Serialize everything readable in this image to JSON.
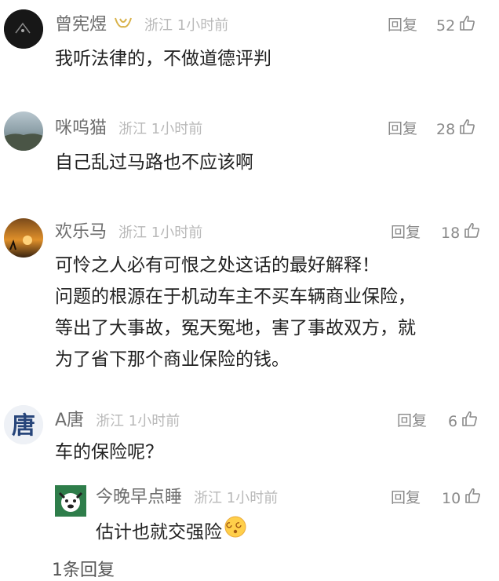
{
  "comments": [
    {
      "name": "曾宪煜",
      "meta": "浙江 1小时前",
      "reply": "回复",
      "likes": "52",
      "text": [
        "我听法律的，不做道德评判"
      ]
    },
    {
      "name": "咪呜猫",
      "meta": "浙江 1小时前",
      "reply": "回复",
      "likes": "28",
      "text": [
        "自己乱过马路也不应该啊"
      ]
    },
    {
      "name": "欢乐马",
      "meta": "浙江 1小时前",
      "reply": "回复",
      "likes": "18",
      "text": [
        "可怜之人必有可恨之处这话的最好解释！",
        "问题的根源在于机动车主不买车辆商业保险，",
        "等出了大事故，冤天冤地，害了事故双方，就",
        "为了省下那个商业保险的钱。"
      ]
    },
    {
      "name": "A唐",
      "meta": "浙江 1小时前",
      "reply": "回复",
      "likes": "6",
      "text": [
        "车的保险呢？"
      ]
    },
    {
      "name": "今晚早点睡",
      "meta": "浙江 1小时前",
      "reply": "回复",
      "likes": "10",
      "text": [
        "估计也就交强险"
      ]
    }
  ],
  "footer": {
    "more_label": "1条回复"
  }
}
